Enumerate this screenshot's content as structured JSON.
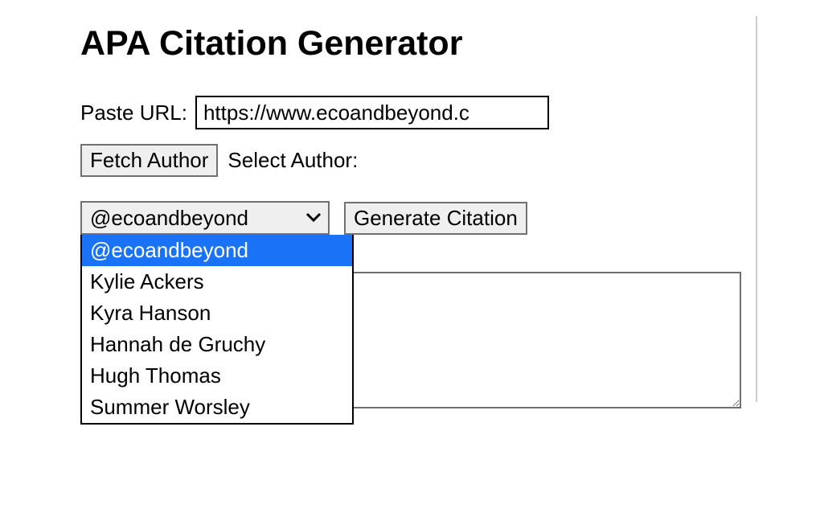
{
  "title": "APA Citation Generator",
  "urlRow": {
    "label": "Paste URL:",
    "value": "https://www.ecoandbeyond.c"
  },
  "fetchRow": {
    "fetchButton": "Fetch Author",
    "selectLabel": "Select Author:"
  },
  "authorSelect": {
    "selected": "@ecoandbeyond",
    "options": [
      "@ecoandbeyond",
      "Kylie Ackers",
      "Kyra Hanson",
      "Hannah de Gruchy",
      "Hugh Thomas",
      "Summer Worsley"
    ]
  },
  "generateButton": "Generate Citation",
  "output": ""
}
